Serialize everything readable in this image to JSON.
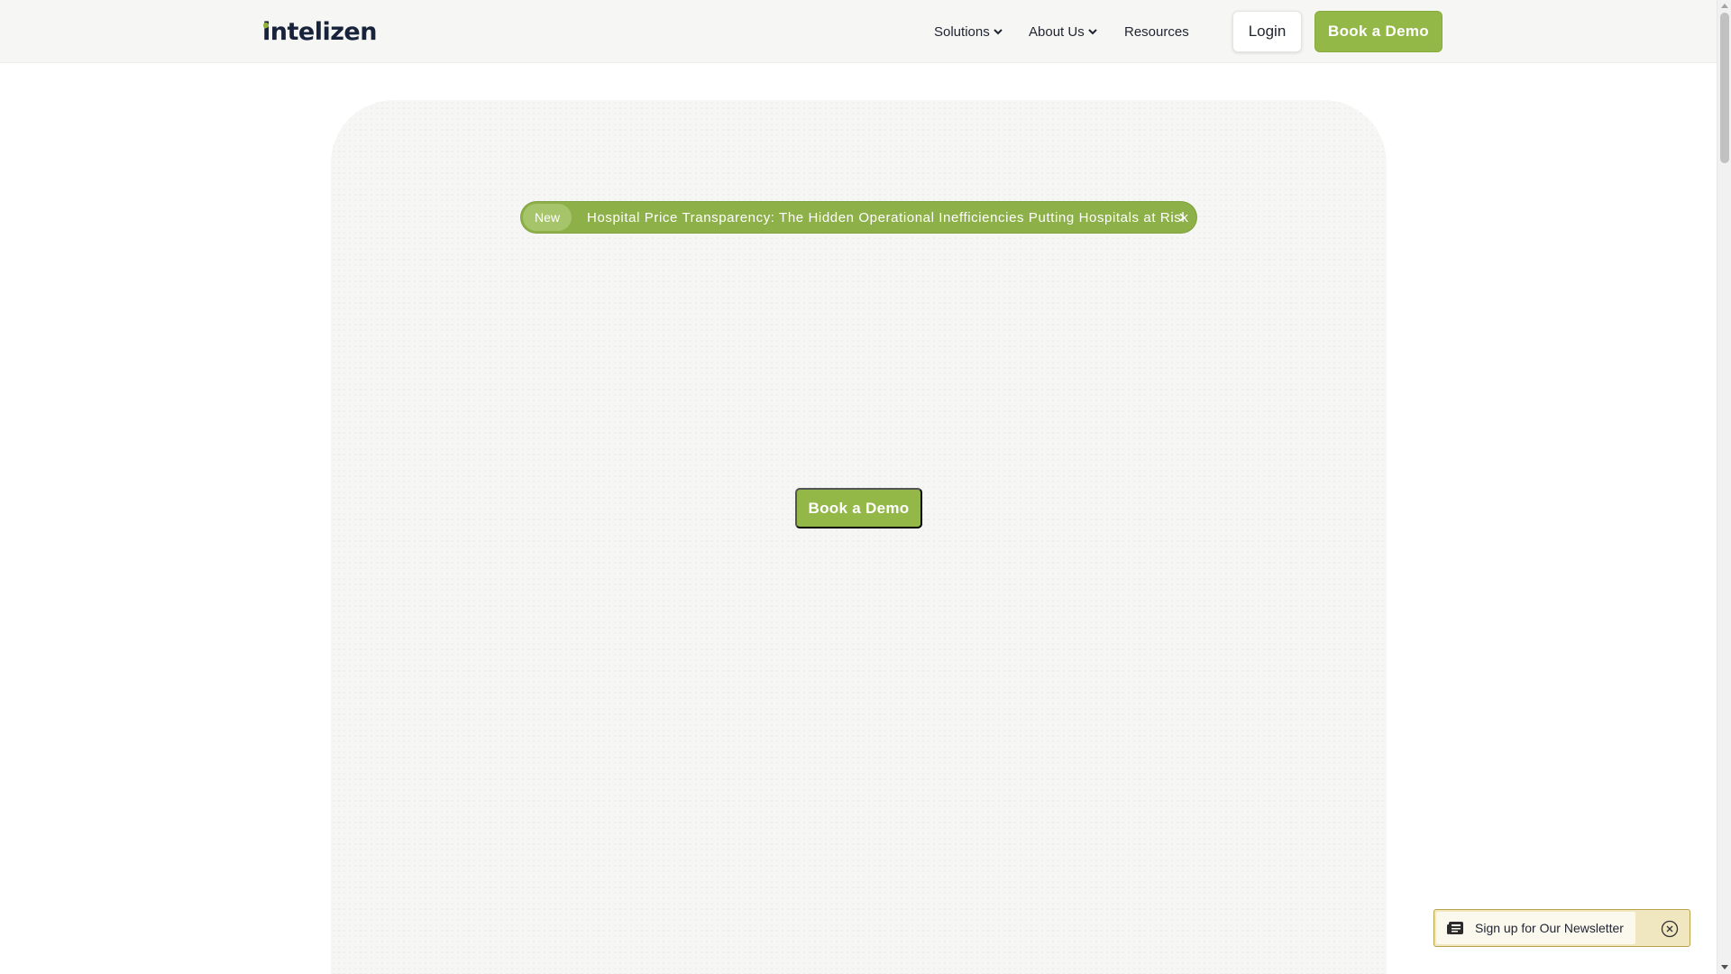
{
  "header": {
    "logo_text": "intelizen",
    "nav": {
      "solutions": "Solutions",
      "about": "About Us",
      "resources": "Resources"
    },
    "login_label": "Login",
    "demo_label": "Book a Demo"
  },
  "hero": {
    "badge": "New",
    "announcement": "Hospital Price Transparency: The Hidden Operational Inefficiencies Putting Hospitals at Risk",
    "cta_label": "Book a Demo"
  },
  "newsletter": {
    "label": "Sign up for Our Newsletter"
  },
  "colors": {
    "brand_green": "#93b848",
    "logo_navy": "#17223b"
  },
  "icons": {
    "nav_dropdown": "chevron-down-icon",
    "announcement_arrow": "chevron-right-icon",
    "newsletter": "newspaper-icon",
    "close": "close-circle-icon"
  }
}
